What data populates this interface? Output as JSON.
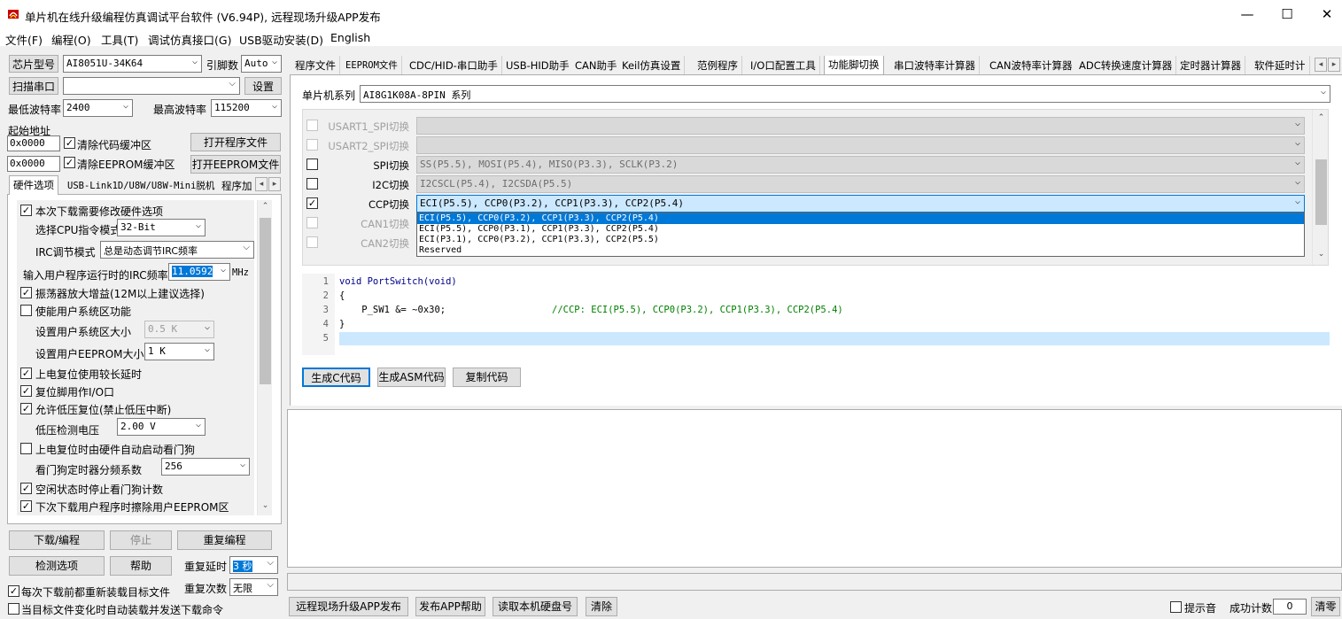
{
  "window": {
    "title": "单片机在线升级编程仿真调试平台软件 (V6.94P), 远程现场升级APP发布",
    "minimize": "—",
    "maximize": "☐",
    "close": "✕"
  },
  "menu": [
    "文件(F)",
    "编程(O)",
    "工具(T)",
    "调试仿真接口(G)",
    "USB驱动安装(D)",
    "English"
  ],
  "left": {
    "chip_btn": "芯片型号",
    "chip_value": "AI8051U-34K64",
    "pins_label": "引脚数",
    "pins_value": "Auto",
    "scan_btn": "扫描串口",
    "port_value": "",
    "settings_btn": "设置",
    "min_baud_label": "最低波特率",
    "min_baud": "2400",
    "max_baud_label": "最高波特率",
    "max_baud": "115200",
    "start_addr_label": "起始地址",
    "addr1": "0x0000",
    "clear_code": "清除代码缓冲区",
    "open_prog": "打开程序文件",
    "addr2": "0x0000",
    "clear_eeprom": "清除EEPROM缓冲区",
    "open_eeprom": "打开EEPROM文件",
    "tabs": [
      "硬件选项",
      "USB-Link1D/U8W/U8W-Mini脱机",
      "程序加"
    ],
    "hw": {
      "opt1": "本次下载需要修改硬件选项",
      "cpu_label": "选择CPU指令模式",
      "cpu_value": "32-Bit",
      "irc_label": "IRC调节模式",
      "irc_value": "总是动态调节IRC频率",
      "freq_label": "输入用户程序运行时的IRC频率",
      "freq_value": "11.0592",
      "freq_unit": "MHz",
      "osc": "振荡器放大增益(12M以上建议选择)",
      "sysarea": "使能用户系统区功能",
      "sys_size_label": "设置用户系统区大小",
      "sys_size": "0.5 K",
      "eeprom_size_label": "设置用户EEPROM大小",
      "eeprom_size": "1   K",
      "long_delay": "上电复位使用较长延时",
      "reset_io": "复位脚用作I/O口",
      "lvr": "允许低压复位(禁止低压中断)",
      "lvd_label": "低压检测电压",
      "lvd_value": "2.00 V",
      "wdt_auto": "上电复位时由硬件自动启动看门狗",
      "wdt_div_label": "看门狗定时器分频系数",
      "wdt_div": "256",
      "idle_wdt": "空闲状态时停止看门狗计数",
      "erase_eeprom": "下次下载用户程序时擦除用户EEPROM区"
    },
    "download_btn": "下载/编程",
    "stop_btn": "停止",
    "reprog_btn": "重复编程",
    "check_btn": "检测选项",
    "help_btn": "帮助",
    "repeat_delay_label": "重复延时",
    "repeat_delay": "3 秒",
    "repeat_count_label": "重复次数",
    "repeat_count": "无限",
    "reload_label": "每次下载前都重新装载目标文件",
    "auto_send_label": "当目标文件变化时自动装载并发送下载命令"
  },
  "right": {
    "tabs": [
      "程序文件",
      "EEPROM文件",
      "CDC/HID-串口助手",
      "USB-HID助手",
      "CAN助手",
      "Keil仿真设置",
      "范例程序",
      "I/O口配置工具",
      "功能脚切换",
      "串口波特率计算器",
      "CAN波特率计算器",
      "ADC转换速度计算器",
      "定时器计算器",
      "软件延时计"
    ],
    "series_label": "单片机系列",
    "series_value": "AI8G1K08A-8PIN 系列",
    "rows": [
      {
        "label": "USART1_SPI切换",
        "value": ""
      },
      {
        "label": "USART2_SPI切换",
        "value": ""
      },
      {
        "label": "SPI切换",
        "value": "SS(P5.5), MOSI(P5.4), MISO(P3.3), SCLK(P3.2)"
      },
      {
        "label": "I2C切换",
        "value": "I2CSCL(P5.4), I2CSDA(P5.5)"
      },
      {
        "label": "CCP切换",
        "value": "ECI(P5.5), CCP0(P3.2), CCP1(P3.3), CCP2(P5.4)"
      },
      {
        "label": "CAN1切换",
        "value": ""
      },
      {
        "label": "CAN2切换",
        "value": ""
      }
    ],
    "dropdown": [
      "ECI(P5.5), CCP0(P3.2), CCP1(P3.3), CCP2(P5.4)",
      "ECI(P5.5), CCP0(P3.1), CCP1(P3.3), CCP2(P5.4)",
      "ECI(P3.1), CCP0(P3.2), CCP1(P3.3), CCP2(P5.5)",
      "Reserved"
    ],
    "code": [
      "void PortSwitch(void)",
      "{",
      "    P_SW1 &= ~0x30;",
      "}",
      ""
    ],
    "code_comment": "//CCP: ECI(P5.5), CCP0(P3.2), CCP1(P3.3), CCP2(P5.4)",
    "line_nums": [
      "1",
      "2",
      "3",
      "4",
      "5"
    ],
    "gen_btn": "生成C代码",
    "gen_asm_btn": "生成ASM代码",
    "copy_btn": "复制代码",
    "bottom": {
      "publish_btn": "远程现场升级APP发布",
      "publish_help_btn": "发布APP帮助",
      "read_hdd_btn": "读取本机硬盘号",
      "clear_btn": "清除",
      "tip_label": "提示音",
      "count_label": "成功计数",
      "count_value": "0",
      "reset_btn": "清零"
    }
  }
}
